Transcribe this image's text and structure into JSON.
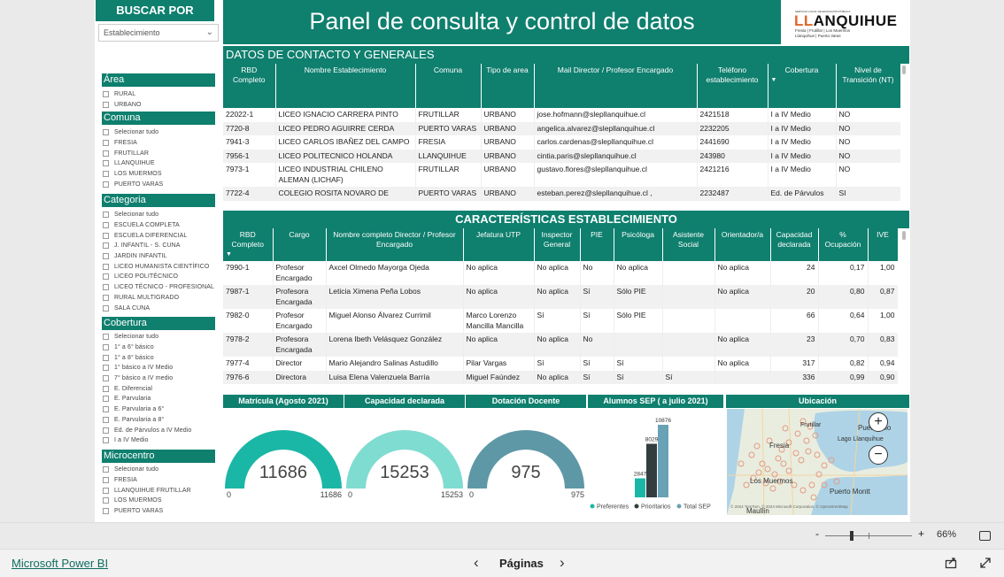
{
  "sidebar": {
    "header": "BUSCAR POR",
    "dropdown_value": "Establecimiento",
    "area": {
      "title": "Área",
      "items": [
        "RURAL",
        "URBANO"
      ]
    },
    "comuna": {
      "title": "Comuna",
      "items": [
        "Selecionar tudo",
        "FRESIA",
        "FRUTILLAR",
        "LLANQUIHUE",
        "LOS MUERMOS",
        "PUERTO VARAS"
      ]
    },
    "categoria": {
      "title": "Categoria",
      "items": [
        "Selecionar tudo",
        "ESCUELA COMPLETA",
        "ESCUELA DIFERENCIAL",
        "J. INFANTIL - S. CUNA",
        "JARDIN INFANTIL",
        "LICEO HUMANISTA CIENTÍFICO",
        "LICEO POLITÉCNICO",
        "LICEO TÉCNICO - PROFESIONAL",
        "RURAL MULTIGRADO",
        "SALA CUNA"
      ]
    },
    "cobertura": {
      "title": "Cobertura",
      "items": [
        "Selecionar tudo",
        "1° a 6° básico",
        "1° a 8° básico",
        "1° básico a IV Medio",
        "7° básico a IV medio",
        "E. Diferencial",
        "E. Parvularia",
        "E. Parvularia a 6°",
        "E. Parvularia a 8°",
        "Ed. de Párvulos a IV Medio",
        "I a IV Medio"
      ]
    },
    "microcentro": {
      "title": "Microcentro",
      "items": [
        "Selecionar tudo",
        "FRESIA",
        "LLANQUIHUE FRUTILLAR",
        "LOS MUERMOS",
        "PUERTO VARAS"
      ]
    }
  },
  "header": {
    "title": "Panel de consulta y control de datos",
    "logo_small": "SERVICIO LOCAL DE EDUCACIÓN PÚBLICA",
    "logo_name_a": "LL",
    "logo_name_b": "ANQUIHUE",
    "logo_sub1": "Fresia | Frutillar | Los Muermos",
    "logo_sub2": "Llanquihue | Puerto Varas"
  },
  "contacto": {
    "title": "DATOS DE CONTACTO Y GENERALES",
    "columns": [
      "RBD Completo",
      "Nombre Establecimiento",
      "Comuna",
      "Tipo de area",
      "Mail Director / Profesor Encargado",
      "Teléfono establecimiento",
      "Cobertura",
      "Nivel de Transición (NT)"
    ],
    "rows": [
      [
        "22022-1",
        "LICEO IGNACIO CARRERA PINTO",
        "FRUTILLAR",
        "URBANO",
        "jose.hofmann@slepllanquihue.cl",
        "2421518",
        "I a IV Medio",
        "NO"
      ],
      [
        "7720-8",
        "LICEO PEDRO AGUIRRE CERDA",
        "PUERTO VARAS",
        "URBANO",
        "angelica.alvarez@slepllanquihue.cl",
        "2232205",
        "I a IV Medio",
        "NO"
      ],
      [
        "7941-3",
        "LICEO CARLOS IBAÑEZ DEL CAMPO",
        "FRESIA",
        "URBANO",
        "carlos.cardenas@slepllanquihue.cl",
        "2441690",
        "I a IV Medio",
        "NO"
      ],
      [
        "7956-1",
        "LICEO POLITECNICO HOLANDA",
        "LLANQUIHUE",
        "URBANO",
        "cintia.paris@slepllanquihue.cl",
        "243980",
        "I a IV Medio",
        "NO"
      ],
      [
        "7973-1",
        "LICEO INDUSTRIAL CHILENO ALEMAN (LICHAF)",
        "FRUTILLAR",
        "URBANO",
        "gustavo.flores@slepllanquihue.cl",
        "2421216",
        "I a IV Medio",
        "NO"
      ],
      [
        "7722-4",
        "COLEGIO ROSITA NOVARO DE",
        "PUERTO VARAS",
        "URBANO",
        "esteban.perez@slepllanquihue.cl ,",
        "2232487",
        "Ed. de Párvulos",
        "SI"
      ]
    ]
  },
  "caracteristicas": {
    "title": "CARACTERÍSTICAS ESTABLECIMIENTO",
    "columns": [
      "RBD Completo",
      "Cargo",
      "Nombre completo Director / Profesor Encargado",
      "Jefatura UTP",
      "Inspector General",
      "PIE",
      "Psicóloga",
      "Asistente Social",
      "Orientador/a",
      "Capacidad declarada",
      "% Ocupación",
      "IVE"
    ],
    "rows": [
      [
        "7990-1",
        "Profesor Encargado",
        "Axcel Olmedo Mayorga Ojeda",
        "No aplica",
        "No aplica",
        "No",
        "No aplica",
        "",
        "No aplica",
        "24",
        "0,17",
        "1,00"
      ],
      [
        "7987-1",
        "Profesora Encargada",
        "Leticia Ximena Peña Lobos",
        "No aplica",
        "No aplica",
        "Sí",
        "Sólo PIE",
        "",
        "No aplica",
        "20",
        "0,80",
        "0,87"
      ],
      [
        "7982-0",
        "Profesor Encargado",
        "Miguel Alonso Álvarez Currimil",
        "Marco Lorenzo Mancilla Mancilla",
        "Sí",
        "Sí",
        "Sólo PIE",
        "",
        "",
        "66",
        "0,64",
        "1,00"
      ],
      [
        "7978-2",
        "Profesora Encargada",
        "Lorena Ibeth Velásquez González",
        "No aplica",
        "No aplica",
        "No",
        "",
        "",
        "No aplica",
        "23",
        "0,70",
        "0,83"
      ],
      [
        "7977-4",
        "Director",
        "Mario Alejandro Salinas Astudillo",
        "Pilar Vargas",
        "Sí",
        "Sí",
        "Sí",
        "",
        "No aplica",
        "317",
        "0,82",
        "0,94"
      ],
      [
        "7976-6",
        "Directora",
        "Luisa Elena Valenzuela Barría",
        "Miguel Faúndez",
        "No aplica",
        "Sí",
        "Sí",
        "Sí",
        "",
        "336",
        "0,99",
        "0,90"
      ]
    ]
  },
  "kpis": [
    {
      "title": "Matrícula (Agosto 2021)",
      "value": "11686",
      "min": "0",
      "max": "11686",
      "fraction": 1.0,
      "color": "#1ab7a6"
    },
    {
      "title": "Capacidad declarada",
      "value": "15253",
      "min": "0",
      "max": "15253",
      "fraction": 1.0,
      "color": "#7fdcd0"
    },
    {
      "title": "Dotación Docente",
      "value": "975",
      "min": "0",
      "max": "975",
      "fraction": 1.0,
      "color": "#5e98a6"
    }
  ],
  "sep": {
    "title": "Alumnos SEP ( a julio 2021)",
    "labels": [
      "2847",
      "8029",
      "10876"
    ],
    "legend": [
      "Preferentes",
      "Prioritarios",
      "Total SEP"
    ],
    "colors": [
      "#1ab7a6",
      "#333d40",
      "#6aa2b5"
    ]
  },
  "chart_data": {
    "type": "bar",
    "title": "Alumnos SEP ( a julio 2021)",
    "categories": [
      "Preferentes",
      "Prioritarios",
      "Total SEP"
    ],
    "values": [
      2847,
      8029,
      10876
    ],
    "legend_position": "bottom"
  },
  "map": {
    "title": "Ubicación",
    "labels": [
      "Puerto Klo",
      "Lago Llanquihue",
      "Frutillar",
      "Fresia",
      "Los Muermos",
      "Puerto Montt",
      "Maullín"
    ],
    "copyright": "© 2024 TomTom, © 2024 Microsoft Corporation, © OpenStreetMap",
    "zoom_in": "+",
    "zoom_out": "−"
  },
  "zoom": {
    "minus": "-",
    "plus": "+",
    "percent": "66%"
  },
  "footer": {
    "brand": "Microsoft Power BI",
    "pages": "Páginas",
    "prev": "‹",
    "next": "›"
  }
}
